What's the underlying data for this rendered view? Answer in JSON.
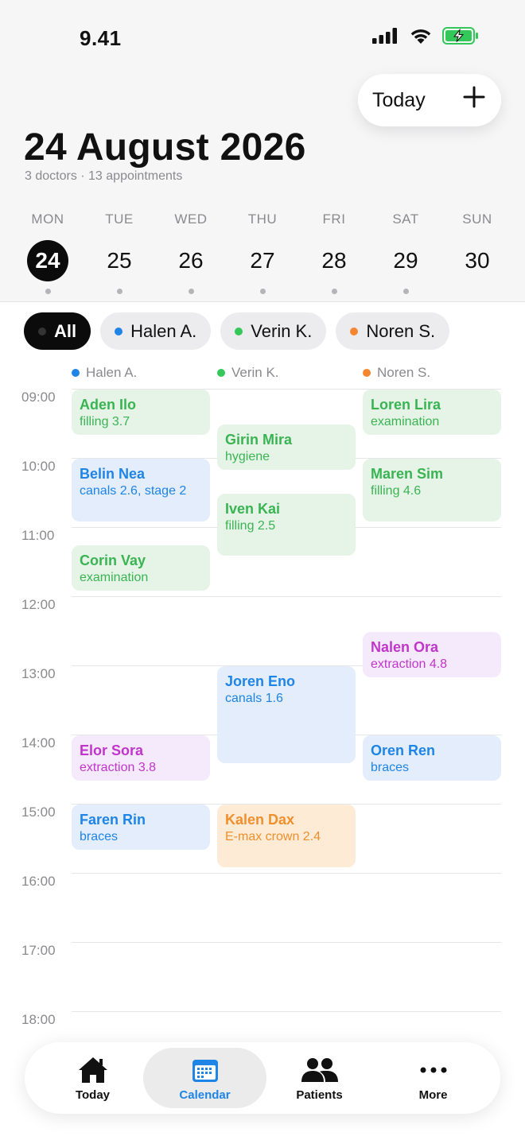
{
  "status_bar": {
    "time": "9.41"
  },
  "header": {
    "today_button": "Today",
    "title": "24 August 2026",
    "subtitle": "3 doctors · 13 appointments"
  },
  "week": [
    {
      "name": "MON",
      "num": "24",
      "selected": true
    },
    {
      "name": "TUE",
      "num": "25"
    },
    {
      "name": "WED",
      "num": "26"
    },
    {
      "name": "THU",
      "num": "27"
    },
    {
      "name": "FRI",
      "num": "28"
    },
    {
      "name": "SAT",
      "num": "29"
    },
    {
      "name": "SUN",
      "num": "30"
    }
  ],
  "filters": [
    {
      "label": "All",
      "active": true
    },
    {
      "label": "Halen A.",
      "color": "#1e84e6"
    },
    {
      "label": "Verin K.",
      "color": "#34c759"
    },
    {
      "label": "Noren S.",
      "color": "#f5862f"
    }
  ],
  "columns": [
    {
      "label": "Halen A.",
      "color": "#1e84e6"
    },
    {
      "label": "Verin K.",
      "color": "#34c759"
    },
    {
      "label": "Noren S.",
      "color": "#f5862f"
    }
  ],
  "hours": [
    "09:00",
    "10:00",
    "11:00",
    "12:00",
    "13:00",
    "14:00",
    "15:00",
    "16:00",
    "17:00",
    "18:00"
  ],
  "appointments": [
    {
      "name": "Aden Ilo",
      "desc": "filling 3.7",
      "color": "green",
      "column": 0,
      "start": "09:00",
      "end": "09:40"
    },
    {
      "name": "Belin Nea",
      "desc": "canals 2.6, stage 2",
      "color": "blue",
      "column": 0,
      "start": "10:00",
      "end": "10:55"
    },
    {
      "name": "Corin Vay",
      "desc": "examination",
      "color": "green",
      "column": 0,
      "start": "11:15",
      "end": "11:55"
    },
    {
      "name": "Elor Sora",
      "desc": "extraction 3.8",
      "color": "purple",
      "column": 0,
      "start": "14:00",
      "end": "14:40"
    },
    {
      "name": "Faren Rin",
      "desc": "braces",
      "color": "blue",
      "column": 0,
      "start": "15:00",
      "end": "15:40"
    },
    {
      "name": "Girin Mira",
      "desc": "hygiene",
      "color": "green",
      "column": 1,
      "start": "09:30",
      "end": "10:10"
    },
    {
      "name": "Iven Kai",
      "desc": "filling 2.5",
      "color": "green",
      "column": 1,
      "start": "10:30",
      "end": "11:25"
    },
    {
      "name": "Joren Eno",
      "desc": "canals 1.6",
      "color": "blue",
      "column": 1,
      "start": "13:00",
      "end": "14:25"
    },
    {
      "name": "Kalen Dax",
      "desc": "E-max crown 2.4",
      "color": "orange",
      "column": 1,
      "start": "15:00",
      "end": "15:55"
    },
    {
      "name": "Loren Lira",
      "desc": "examination",
      "color": "green",
      "column": 2,
      "start": "09:00",
      "end": "09:40"
    },
    {
      "name": "Maren Sim",
      "desc": "filling 4.6",
      "color": "green",
      "column": 2,
      "start": "10:00",
      "end": "10:55"
    },
    {
      "name": "Nalen Ora",
      "desc": "extraction 4.8",
      "color": "purple",
      "column": 2,
      "start": "12:30",
      "end": "13:10"
    },
    {
      "name": "Oren Ren",
      "desc": "braces",
      "color": "blue",
      "column": 2,
      "start": "14:00",
      "end": "14:40"
    }
  ],
  "tabbar": [
    {
      "label": "Today",
      "icon": "home-icon"
    },
    {
      "label": "Calendar",
      "icon": "calendar-icon",
      "active": true
    },
    {
      "label": "Patients",
      "icon": "patients-icon"
    },
    {
      "label": "More",
      "icon": "more-icon"
    }
  ]
}
